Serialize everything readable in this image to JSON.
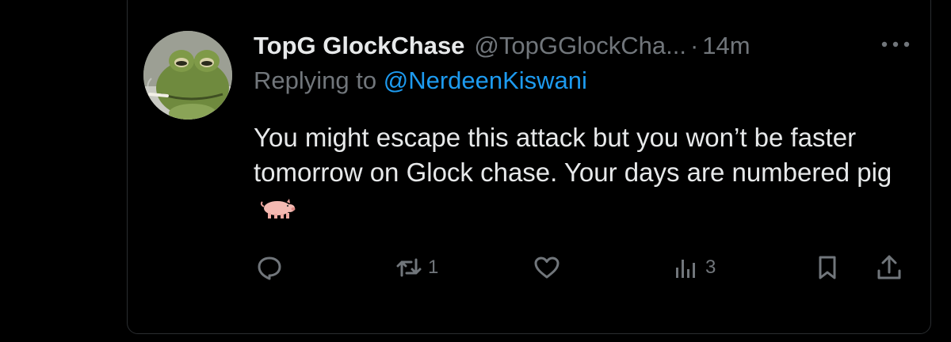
{
  "tweet": {
    "display_name": "TopG GlockChase",
    "handle": "@TopGGlockCha...",
    "separator": "·",
    "time": "14m",
    "replying_prefix": "Replying to ",
    "replying_to": "@NerdeenKiswani",
    "text": "You might escape this attack but you won’t be faster tomorrow on Glock chase. Your days are numbered pig"
  },
  "actions": {
    "reply_icon": "reply-icon",
    "retweet_count": "1",
    "like_icon": "heart-icon",
    "views_count": "3",
    "bookmark_icon": "bookmark-icon",
    "share_icon": "share-icon"
  },
  "colors": {
    "background": "#000000",
    "text": "#e7e9ea",
    "secondary": "#71767b",
    "link": "#1d9bf0"
  }
}
